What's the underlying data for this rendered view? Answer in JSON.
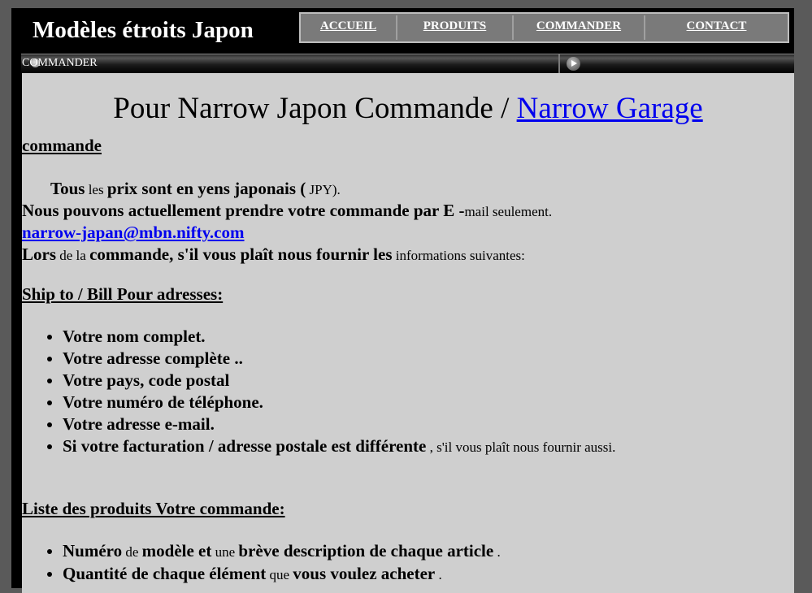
{
  "header": {
    "brand": "Modèles étroits Japon",
    "nav": [
      "ACCUEIL",
      "PRODUITS",
      "COMMANDER",
      "CONTACT"
    ]
  },
  "breadcrumb": {
    "label": "COMMANDER"
  },
  "main": {
    "title_prefix": "Pour Narrow Japon Commande / ",
    "title_link": "Narrow Garage",
    "section_order": "commande",
    "price_bold1": "Tous",
    "price_small1": " les ",
    "price_bold2": "prix sont en yens japonais (",
    "price_small2": " JPY).",
    "email_bold": "Nous pouvons actuellement prendre votre commande par E -",
    "email_small": "mail seulement.",
    "email_address": "narrow-japan@mbn.nifty.com",
    "info_bold1": "Lors",
    "info_small1": " de la ",
    "info_bold2": "commande, s'il vous plaît nous fournir les",
    "info_small2": " informations suivantes:",
    "section_ship": "Ship to / Bill Pour adresses:",
    "ship_items": [
      "Votre nom complet.",
      "Votre adresse complète ..",
      "Votre pays, code postal",
      "Votre numéro de téléphone.",
      "Votre adresse e-mail."
    ],
    "ship_last_bold": "Si votre facturation / adresse postale est différente",
    "ship_last_small": " , s'il vous plaît nous fournir aussi.",
    "section_products": "Liste des produits Votre commande:",
    "prod1_b1": "Numéro",
    "prod1_s1": " de ",
    "prod1_b2": "modèle et",
    "prod1_s2": " une ",
    "prod1_b3": "brève description de chaque article",
    "prod1_s3": " .",
    "prod2_b1": "Quantité de chaque élément",
    "prod2_s1": " que ",
    "prod2_b2": "vous voulez acheter",
    "prod2_s2": " ."
  }
}
